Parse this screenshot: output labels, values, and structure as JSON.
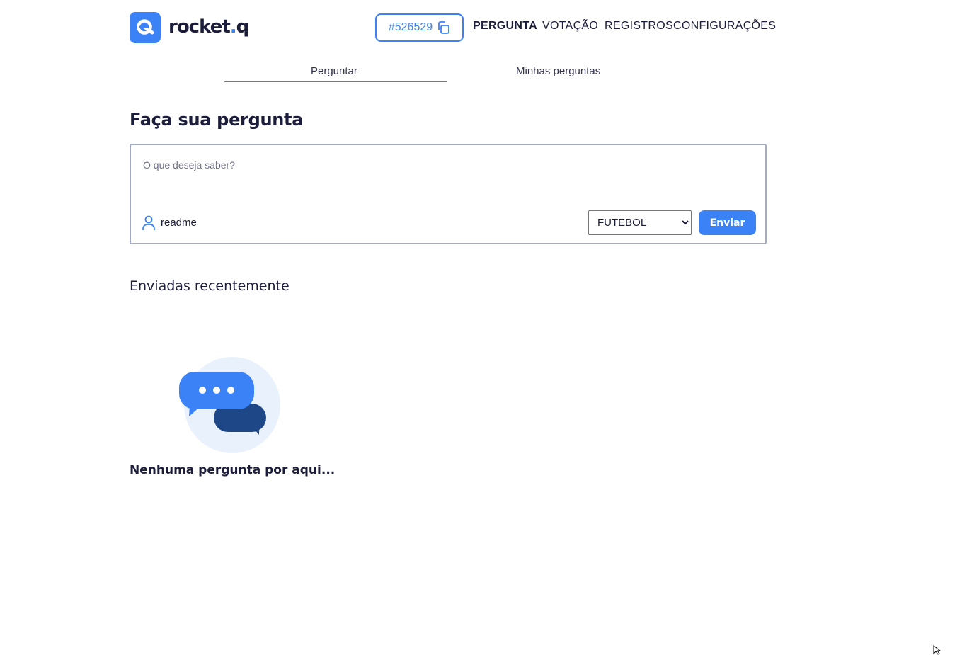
{
  "brand": {
    "name_main": "rocket",
    "name_dot": ".",
    "name_tail": "q"
  },
  "room": {
    "code": "#526529"
  },
  "nav": {
    "items": [
      {
        "label": "PERGUNTA",
        "active": true
      },
      {
        "label": "VOTAÇÃO",
        "active": false
      },
      {
        "label": "REGISTROS",
        "active": false
      },
      {
        "label": "CONFIGURAÇÕES",
        "active": false
      }
    ]
  },
  "tabs": [
    {
      "label": "Perguntar",
      "active": true
    },
    {
      "label": "Minhas perguntas",
      "active": false
    }
  ],
  "form": {
    "title": "Faça sua pergunta",
    "placeholder": "O que deseja saber?",
    "value": "",
    "user": "readme",
    "category_selected": "FUTEBOL",
    "submit_label": "Enviar"
  },
  "recent": {
    "title": "Enviadas recentemente",
    "empty_text": "Nenhuma pergunta por aqui..."
  },
  "colors": {
    "accent": "#3b82f6",
    "dark": "#1c1d3a",
    "bubble_dark": "#1e4788",
    "illustration_bg": "#e9f1fd",
    "border": "#a3aac6"
  },
  "icons": {
    "logo": "search-chat-icon",
    "copy": "copy-icon",
    "user": "user-icon",
    "chevron": "chevron-down-icon",
    "empty": "chat-bubbles-icon"
  }
}
